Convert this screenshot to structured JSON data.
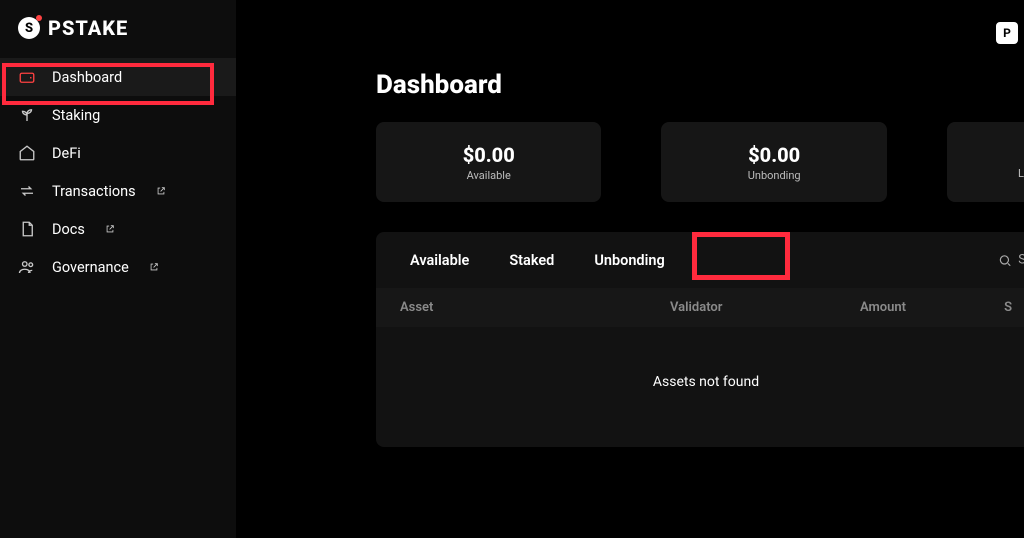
{
  "brand": {
    "logo_letter": "S",
    "name": "PSTAKE"
  },
  "topright_badge": "P",
  "sidebar": {
    "items": [
      {
        "label": "Dashboard",
        "icon": "wallet-icon",
        "active": true,
        "external": false
      },
      {
        "label": "Staking",
        "icon": "plant-icon",
        "active": false,
        "external": false
      },
      {
        "label": "DeFi",
        "icon": "home-icon",
        "active": false,
        "external": false
      },
      {
        "label": "Transactions",
        "icon": "swap-icon",
        "active": false,
        "external": true
      },
      {
        "label": "Docs",
        "icon": "doc-icon",
        "active": false,
        "external": true
      },
      {
        "label": "Governance",
        "icon": "people-icon",
        "active": false,
        "external": true
      }
    ]
  },
  "page": {
    "title": "Dashboard"
  },
  "summary_cards": [
    {
      "value": "$0.00",
      "label": "Available"
    },
    {
      "value": "$0.00",
      "label": "Unbonding"
    },
    {
      "value": "",
      "label": "L"
    }
  ],
  "tabs": [
    {
      "label": "Available",
      "selected": false
    },
    {
      "label": "Staked",
      "selected": true
    },
    {
      "label": "Unbonding",
      "selected": false
    }
  ],
  "search": {
    "placeholder": "S"
  },
  "table": {
    "columns": [
      "Asset",
      "Validator",
      "Amount",
      "S"
    ],
    "empty_message": "Assets not found"
  },
  "highlights": {
    "sidebar_item_index": 0,
    "tab_index": 1
  }
}
